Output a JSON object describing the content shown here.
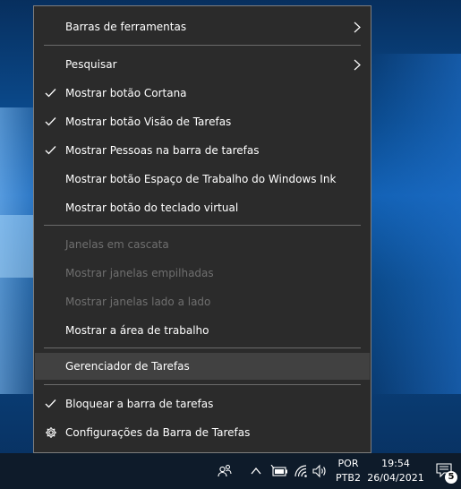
{
  "menu": {
    "items": [
      {
        "label": "Barras de ferramentas",
        "checked": false,
        "submenu": true,
        "disabled": false
      },
      {
        "label": "Pesquisar",
        "checked": false,
        "submenu": true,
        "disabled": false
      },
      {
        "label": "Mostrar botão Cortana",
        "checked": true,
        "submenu": false,
        "disabled": false
      },
      {
        "label": "Mostrar botão Visão de Tarefas",
        "checked": true,
        "submenu": false,
        "disabled": false
      },
      {
        "label": "Mostrar Pessoas na barra de tarefas",
        "checked": true,
        "submenu": false,
        "disabled": false
      },
      {
        "label": "Mostrar botão Espaço de Trabalho do Windows Ink",
        "checked": false,
        "submenu": false,
        "disabled": false
      },
      {
        "label": "Mostrar botão do teclado virtual",
        "checked": false,
        "submenu": false,
        "disabled": false
      },
      {
        "label": "Janelas em cascata",
        "checked": false,
        "submenu": false,
        "disabled": true
      },
      {
        "label": "Mostrar janelas empilhadas",
        "checked": false,
        "submenu": false,
        "disabled": true
      },
      {
        "label": "Mostrar janelas lado a lado",
        "checked": false,
        "submenu": false,
        "disabled": true
      },
      {
        "label": "Mostrar a área de trabalho",
        "checked": false,
        "submenu": false,
        "disabled": false
      },
      {
        "label": "Gerenciador de Tarefas",
        "checked": false,
        "submenu": false,
        "disabled": false,
        "hover": true
      },
      {
        "label": "Bloquear a barra de tarefas",
        "checked": true,
        "submenu": false,
        "disabled": false
      },
      {
        "label": "Configurações da Barra de Tarefas",
        "checked": false,
        "submenu": false,
        "disabled": false,
        "icon": "gear-icon"
      }
    ]
  },
  "taskbar": {
    "language": {
      "line1": "POR",
      "line2": "PTB2"
    },
    "clock": {
      "time": "19:54",
      "date": "26/04/2021"
    },
    "notifications": {
      "count": "5"
    },
    "tray_icons": [
      "people-icon",
      "chevron-up-icon",
      "battery-icon",
      "wifi-icon",
      "speaker-icon"
    ]
  },
  "colors": {
    "menu_bg": "#2b2b2b",
    "hover_bg": "#414141",
    "disabled_text": "#6f6f6f",
    "taskbar_bg": "#0e1b2a"
  }
}
